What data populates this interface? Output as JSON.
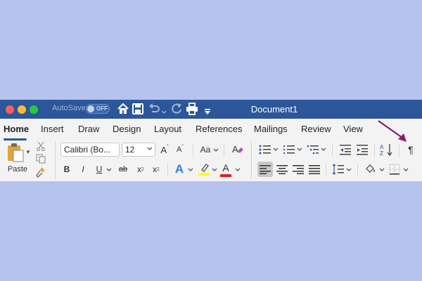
{
  "titlebar": {
    "autosave_label": "AutoSave",
    "autosave_state": "OFF",
    "document_title": "Document1",
    "bar_color": "#2b579a",
    "traffic_lights": [
      "#fe5f57",
      "#febc2e",
      "#28c840"
    ]
  },
  "tabs": [
    {
      "label": "Home",
      "active": true
    },
    {
      "label": "Insert"
    },
    {
      "label": "Draw"
    },
    {
      "label": "Design"
    },
    {
      "label": "Layout"
    },
    {
      "label": "References"
    },
    {
      "label": "Mailings"
    },
    {
      "label": "Review"
    },
    {
      "label": "View"
    }
  ],
  "ribbon": {
    "paste_label": "Paste",
    "font_name": "Calibri (Bo...",
    "font_size": "12",
    "grow_font": "A",
    "shrink_font": "A",
    "change_case": "Aa",
    "bold": "B",
    "italic": "I",
    "underline": "U",
    "strikethrough": "ab",
    "subscript": "x",
    "subscript_mark": "2",
    "superscript": "x",
    "superscript_mark": "2",
    "text_effects": "A",
    "font_color": "A",
    "pilcrow": "¶",
    "highlight_color": "#ffff00",
    "font_color_value": "#e02020"
  },
  "annotation": {
    "arrow_color": "#8b1c6a"
  }
}
